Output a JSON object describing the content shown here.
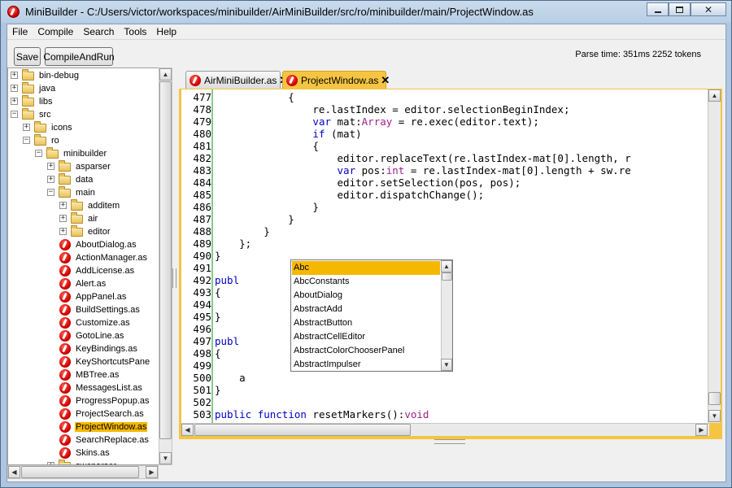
{
  "window": {
    "title": "MiniBuilder - C:/Users/victor/workspaces/minibuilder/AirMiniBuilder/src/ro/minibuilder/main/ProjectWindow.as",
    "close_glyph": "✕"
  },
  "menu": [
    "File",
    "Compile",
    "Search",
    "Tools",
    "Help"
  ],
  "toolbar": {
    "save_label": "Save",
    "compile_label": "CompileAndRun"
  },
  "status": {
    "parse_time": "Parse time: 351ms 2252 tokens"
  },
  "tree": [
    {
      "label": "bin-debug",
      "type": "folder",
      "expander": "+"
    },
    {
      "label": "java",
      "type": "folder",
      "expander": "+"
    },
    {
      "label": "libs",
      "type": "folder",
      "expander": "+"
    },
    {
      "label": "src",
      "type": "folder",
      "expander": "−"
    },
    {
      "label": "icons",
      "type": "folder",
      "expander": "+"
    },
    {
      "label": "ro",
      "type": "folder",
      "expander": "−"
    },
    {
      "label": "minibuilder",
      "type": "folder",
      "expander": "−"
    },
    {
      "label": "asparser",
      "type": "folder",
      "expander": "+"
    },
    {
      "label": "data",
      "type": "folder",
      "expander": "+"
    },
    {
      "label": "main",
      "type": "folder",
      "expander": "−"
    },
    {
      "label": "additem",
      "type": "folder",
      "expander": "+"
    },
    {
      "label": "air",
      "type": "folder",
      "expander": "+"
    },
    {
      "label": "editor",
      "type": "folder",
      "expander": "+"
    },
    {
      "label": "AboutDialog.as",
      "type": "file"
    },
    {
      "label": "ActionManager.as",
      "type": "file"
    },
    {
      "label": "AddLicense.as",
      "type": "file"
    },
    {
      "label": "Alert.as",
      "type": "file"
    },
    {
      "label": "AppPanel.as",
      "type": "file"
    },
    {
      "label": "BuildSettings.as",
      "type": "file"
    },
    {
      "label": "Customize.as",
      "type": "file"
    },
    {
      "label": "GotoLine.as",
      "type": "file"
    },
    {
      "label": "KeyBindings.as",
      "type": "file"
    },
    {
      "label": "KeyShortcutsPane",
      "type": "file"
    },
    {
      "label": "MBTree.as",
      "type": "file"
    },
    {
      "label": "MessagesList.as",
      "type": "file"
    },
    {
      "label": "ProgressPopup.as",
      "type": "file"
    },
    {
      "label": "ProjectSearch.as",
      "type": "file"
    },
    {
      "label": "ProjectWindow.as",
      "type": "file",
      "selected": true
    },
    {
      "label": "SearchReplace.as",
      "type": "file"
    },
    {
      "label": "Skins.as",
      "type": "file"
    },
    {
      "label": "swcparser",
      "type": "folder",
      "expander": "+"
    }
  ],
  "tabs": [
    {
      "label": "AirMiniBuilder.as",
      "close": "✕",
      "active": false
    },
    {
      "label": "ProjectWindow.as",
      "close": "✕",
      "active": true
    }
  ],
  "code": [
    {
      "n": "477",
      "t": "            {"
    },
    {
      "n": "478",
      "t": "                re.lastIndex = editor.selectionBeginIndex;"
    },
    {
      "n": "479",
      "t": "                <k>var</k> mat:<y>Array</y> = re.exec(editor.text);"
    },
    {
      "n": "480",
      "t": "                <k>if</k> (mat)"
    },
    {
      "n": "481",
      "t": "                {"
    },
    {
      "n": "482",
      "t": "                    editor.replaceText(re.lastIndex-mat[0].length, r"
    },
    {
      "n": "483",
      "t": "                    <k>var</k> pos:<y>int</y> = re.lastIndex-mat[0].length + sw.re"
    },
    {
      "n": "484",
      "t": "                    editor.setSelection(pos, pos);"
    },
    {
      "n": "485",
      "t": "                    editor.dispatchChange();"
    },
    {
      "n": "486",
      "t": "                }"
    },
    {
      "n": "487",
      "t": "            }"
    },
    {
      "n": "488",
      "t": "        }"
    },
    {
      "n": "489",
      "t": "    };"
    },
    {
      "n": "490",
      "t": "}"
    },
    {
      "n": "491",
      "t": ""
    },
    {
      "n": "492",
      "t": "<k>publ</k>                  :<y>void</y>"
    },
    {
      "n": "493",
      "t": "{"
    },
    {
      "n": "494",
      "t": "                        ();"
    },
    {
      "n": "495",
      "t": "}"
    },
    {
      "n": "496",
      "t": ""
    },
    {
      "n": "497",
      "t": "<k>publ</k>                  s():<y>void</y>"
    },
    {
      "n": "498",
      "t": "{"
    },
    {
      "n": "499",
      "t": ""
    },
    {
      "n": "500",
      "t": "    a"
    },
    {
      "n": "501",
      "t": "}"
    },
    {
      "n": "502",
      "t": ""
    },
    {
      "n": "503",
      "t": "<k>public</k> <k>function</k> resetMarkers():<y>void</y>"
    }
  ],
  "autocomplete": [
    "Abc",
    "AbcConstants",
    "AboutDialog",
    "AbstractAdd",
    "AbstractButton",
    "AbstractCellEditor",
    "AbstractColorChooserPanel",
    "AbstractImpulser"
  ],
  "icons": {
    "scroll_up": "▲",
    "scroll_down": "▼",
    "scroll_left": "◀",
    "scroll_right": "▶"
  }
}
